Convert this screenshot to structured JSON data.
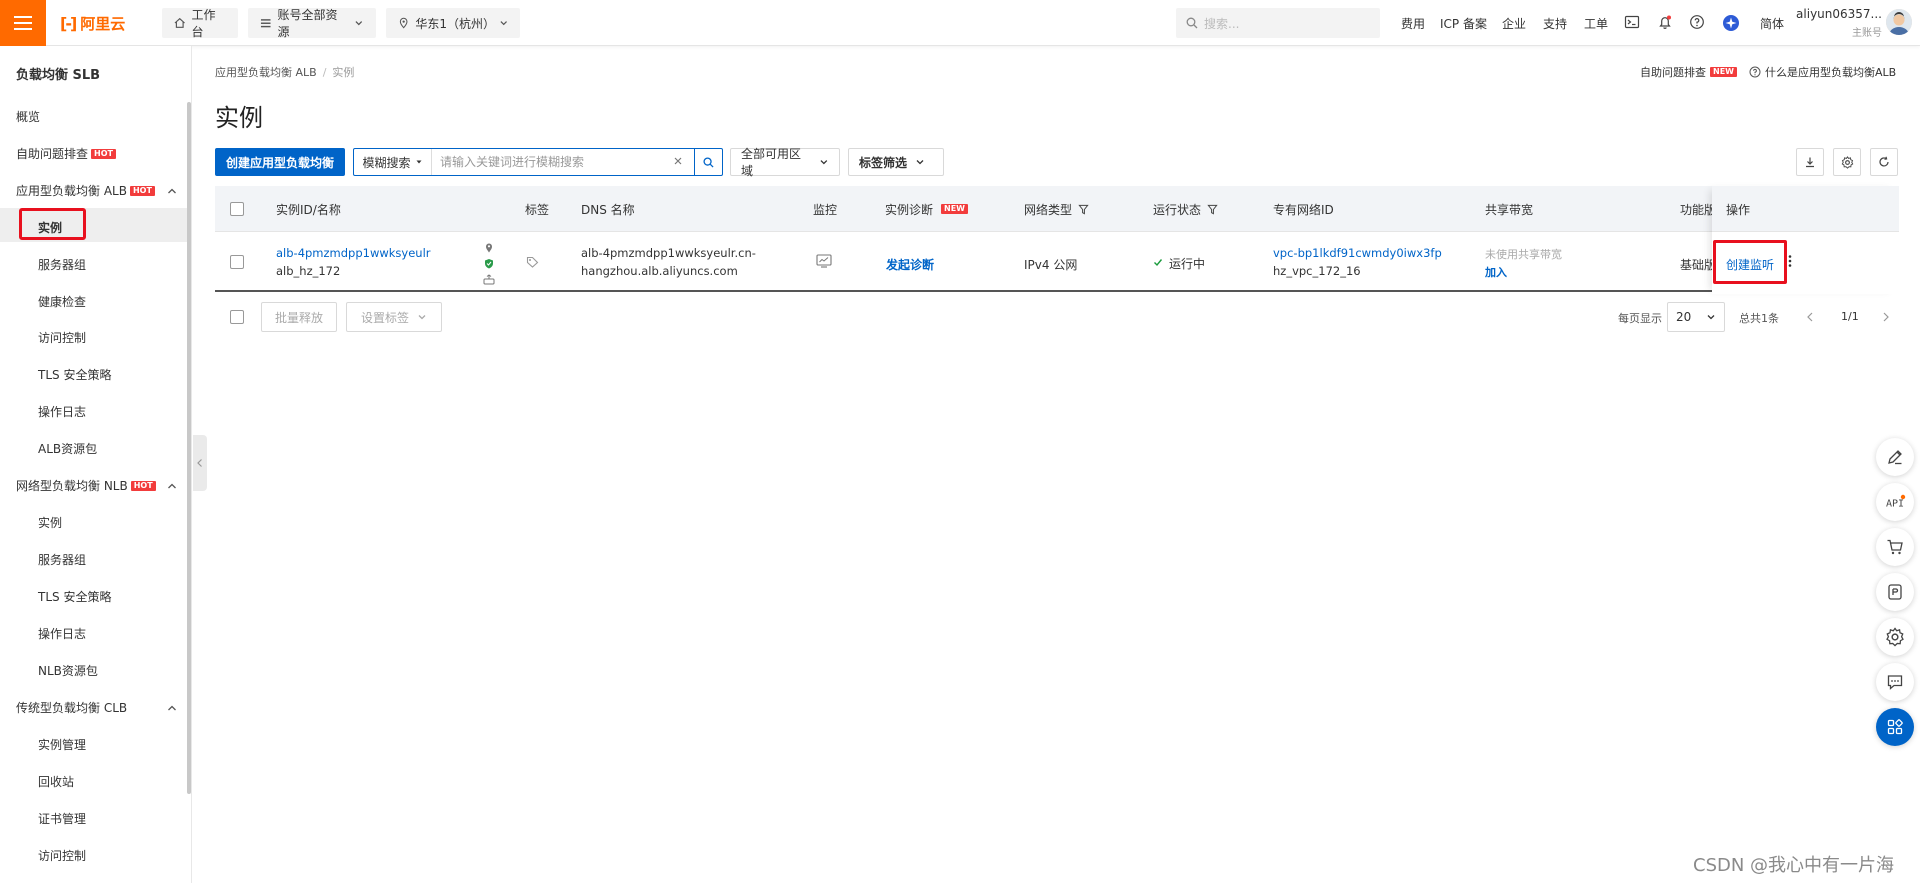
{
  "topbar": {
    "logo_mark": "[-]",
    "logo_text": "阿里云",
    "workbench": "工作台",
    "account_scope": "账号全部资源",
    "region": "华东1（杭州）",
    "search_placeholder": "搜索...",
    "links": [
      "费用",
      "ICP 备案",
      "企业",
      "支持",
      "工单"
    ],
    "lang": "简体",
    "account_name": "aliyun06357...",
    "account_role": "主账号"
  },
  "sidebar": {
    "title": "负载均衡 SLB",
    "overview": "概览",
    "troubleshoot": "自助问题排查",
    "hot": "HOT",
    "alb_group": "应用型负载均衡 ALB",
    "alb_items": [
      "实例",
      "服务器组",
      "健康检查",
      "访问控制",
      "TLS 安全策略",
      "操作日志",
      "ALB资源包"
    ],
    "nlb_group": "网络型负载均衡 NLB",
    "nlb_items": [
      "实例",
      "服务器组",
      "TLS 安全策略",
      "操作日志",
      "NLB资源包"
    ],
    "clb_group": "传统型负载均衡 CLB",
    "clb_items": [
      "实例管理",
      "回收站",
      "证书管理",
      "访问控制"
    ]
  },
  "breadcrumb": {
    "parent": "应用型负载均衡 ALB",
    "sep": "/",
    "current": "实例"
  },
  "header_right": {
    "troubleshoot": "自助问题排查",
    "new": "NEW",
    "help": "什么是应用型负载均衡ALB"
  },
  "page": {
    "title": "实例"
  },
  "toolbar": {
    "create_label": "创建应用型负载均衡",
    "search_mode": "模糊搜索",
    "search_placeholder": "请输入关键词进行模糊搜索",
    "zone_filter": "全部可用区域",
    "tag_filter": "标签筛选"
  },
  "table": {
    "columns": {
      "id_name": "实例ID/名称",
      "tags": "标签",
      "dns": "DNS 名称",
      "monitor": "监控",
      "diagnose": "实例诊断",
      "diagnose_badge": "NEW",
      "network": "网络类型",
      "status": "运行状态",
      "vpc": "专有网络ID",
      "bandwidth": "共享带宽",
      "edition": "功能版",
      "actions": "操作"
    },
    "rows": [
      {
        "id": "alb-4pmzmdpp1wwksyeulr",
        "name": "alb_hz_172",
        "dns_line1": "alb-4pmzmdpp1wwksyeulr.cn-",
        "dns_line2": "hangzhou.alb.aliyuncs.com",
        "diagnose_link": "发起诊断",
        "network": "IPv4 公网",
        "status": "运行中",
        "vpc_id": "vpc-bp1lkdf91cwmdy0iwx3fp",
        "vpc_name": "hz_vpc_172_16",
        "bandwidth_state": "未使用共享带宽",
        "bandwidth_join": "加入",
        "edition": "基础版",
        "action": "创建监听"
      }
    ]
  },
  "footer": {
    "batch_release": "批量释放",
    "set_tags": "设置标签",
    "per_page_label": "每页显示",
    "per_page": "20",
    "total": "总共1条",
    "page": "1/1"
  },
  "colors": {
    "brand_orange": "#ff6a00",
    "primary_blue": "#0064c8",
    "highlight_red": "#e8101e",
    "status_green": "#1a9b3c"
  },
  "watermark": "CSDN @我心中有一片海"
}
